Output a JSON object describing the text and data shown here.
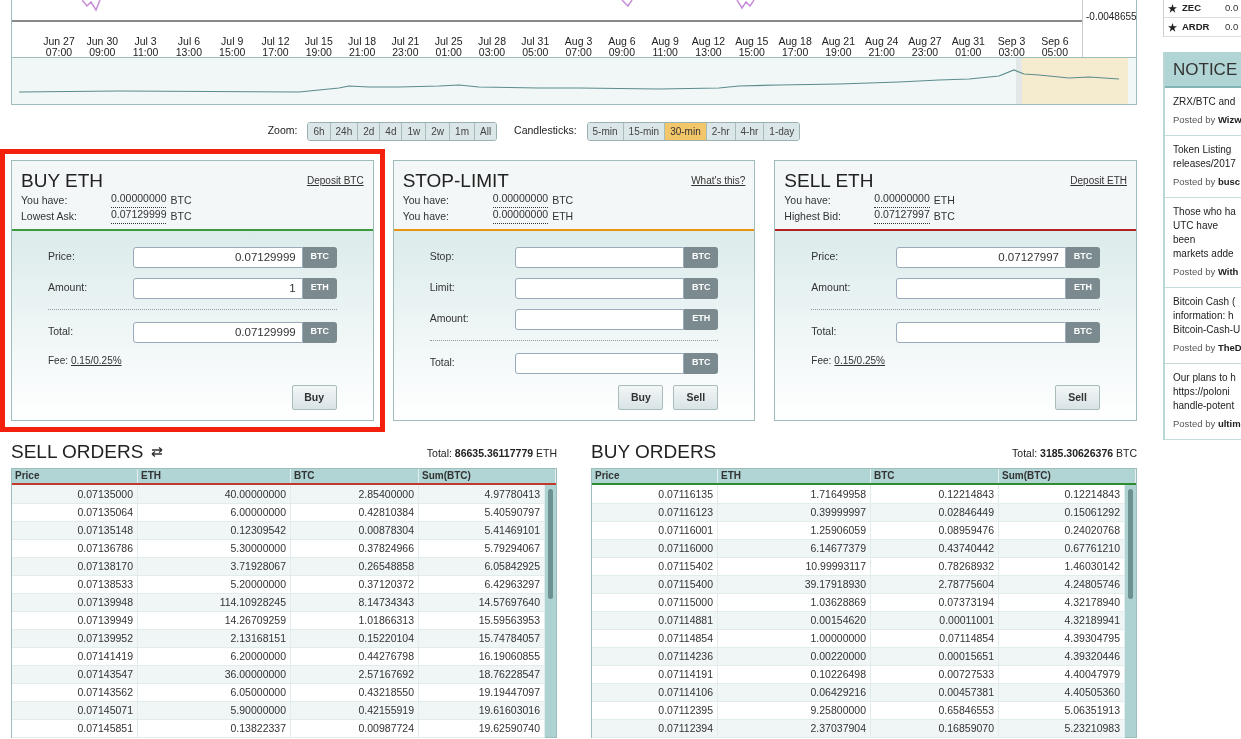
{
  "chart": {
    "y_labels": [
      "-0.0048655"
    ],
    "x_labels": [
      {
        "date": "Jun 27",
        "time": "07:00"
      },
      {
        "date": "Jun 30",
        "time": "09:00"
      },
      {
        "date": "Jul 3",
        "time": "11:00"
      },
      {
        "date": "Jul 6",
        "time": "13:00"
      },
      {
        "date": "Jul 9",
        "time": "15:00"
      },
      {
        "date": "Jul 12",
        "time": "17:00"
      },
      {
        "date": "Jul 15",
        "time": "19:00"
      },
      {
        "date": "Jul 18",
        "time": "21:00"
      },
      {
        "date": "Jul 21",
        "time": "23:00"
      },
      {
        "date": "Jul 25",
        "time": "01:00"
      },
      {
        "date": "Jul 28",
        "time": "03:00"
      },
      {
        "date": "Jul 31",
        "time": "05:00"
      },
      {
        "date": "Aug 3",
        "time": "07:00"
      },
      {
        "date": "Aug 6",
        "time": "09:00"
      },
      {
        "date": "Aug 9",
        "time": "11:00"
      },
      {
        "date": "Aug 12",
        "time": "13:00"
      },
      {
        "date": "Aug 15",
        "time": "15:00"
      },
      {
        "date": "Aug 18",
        "time": "17:00"
      },
      {
        "date": "Aug 21",
        "time": "19:00"
      },
      {
        "date": "Aug 24",
        "time": "21:00"
      },
      {
        "date": "Aug 27",
        "time": "23:00"
      },
      {
        "date": "Aug 31",
        "time": "01:00"
      },
      {
        "date": "Sep 3",
        "time": "03:00"
      },
      {
        "date": "Sep 6",
        "time": "05:00"
      }
    ]
  },
  "zoom": {
    "label": "Zoom:",
    "options": [
      {
        "label": "6h",
        "selected": false
      },
      {
        "label": "24h",
        "selected": false
      },
      {
        "label": "2d",
        "selected": false
      },
      {
        "label": "4d",
        "selected": false
      },
      {
        "label": "1w",
        "selected": false
      },
      {
        "label": "2w",
        "selected": false
      },
      {
        "label": "1m",
        "selected": false
      },
      {
        "label": "All",
        "selected": false
      }
    ]
  },
  "candlesticks": {
    "label": "Candlesticks:",
    "options": [
      {
        "label": "5-min",
        "selected": false
      },
      {
        "label": "15-min",
        "selected": false
      },
      {
        "label": "30-min",
        "selected": true
      },
      {
        "label": "2-hr",
        "selected": false
      },
      {
        "label": "4-hr",
        "selected": false
      },
      {
        "label": "1-day",
        "selected": false
      }
    ]
  },
  "forms": [
    {
      "kind": "buy",
      "title": "BUY ETH",
      "link": "Deposit BTC",
      "highlighted": true,
      "info": [
        {
          "label": "You have:",
          "value": "0.00000000",
          "unit": "BTC"
        },
        {
          "label": "Lowest Ask:",
          "value": "0.07129999",
          "unit": "BTC"
        }
      ],
      "fields": [
        {
          "label": "Price:",
          "value": "0.07129999",
          "unit": "BTC",
          "divider_above": false
        },
        {
          "label": "Amount:",
          "value": "1",
          "unit": "ETH",
          "divider_above": false
        },
        {
          "label": "Total:",
          "value": "0.07129999",
          "unit": "BTC",
          "divider_above": true
        }
      ],
      "fee": {
        "label": "Fee:",
        "value": "0.15/0.25%"
      },
      "buttons": [
        "Buy"
      ]
    },
    {
      "kind": "stop",
      "title": "STOP-LIMIT",
      "link": "What's this?",
      "highlighted": false,
      "info": [
        {
          "label": "You have:",
          "value": "0.00000000",
          "unit": "BTC"
        },
        {
          "label": "You have:",
          "value": "0.00000000",
          "unit": "ETH"
        }
      ],
      "fields": [
        {
          "label": "Stop:",
          "unit": "BTC",
          "divider_above": false
        },
        {
          "label": "Limit:",
          "unit": "BTC",
          "divider_above": false
        },
        {
          "label": "Amount:",
          "unit": "ETH",
          "divider_above": false
        },
        {
          "label": "Total:",
          "unit": "BTC",
          "divider_above": true
        }
      ],
      "buttons": [
        "Buy",
        "Sell"
      ]
    },
    {
      "kind": "sell",
      "title": "SELL ETH",
      "link": "Deposit ETH",
      "highlighted": false,
      "info": [
        {
          "label": "You have:",
          "value": "0.00000000",
          "unit": "ETH"
        },
        {
          "label": "Highest Bid:",
          "value": "0.07127997",
          "unit": "BTC"
        }
      ],
      "fields": [
        {
          "label": "Price:",
          "value": "0.07127997",
          "unit": "BTC",
          "divider_above": false
        },
        {
          "label": "Amount:",
          "unit": "ETH",
          "divider_above": false
        },
        {
          "label": "Total:",
          "unit": "BTC",
          "divider_above": true
        }
      ],
      "fee": {
        "label": "Fee:",
        "value": "0.15/0.25%"
      },
      "buttons": [
        "Sell"
      ]
    }
  ],
  "order_books": [
    {
      "kind": "sell",
      "title": "SELL ORDERS",
      "swap_icon": true,
      "total_label": "Total:",
      "total": "86635.36117779",
      "total_unit": "ETH",
      "columns": [
        "Price",
        "ETH",
        "BTC",
        "Sum(BTC)"
      ],
      "rows": [
        [
          "0.07135000",
          "40.00000000",
          "2.85400000",
          "4.97780413"
        ],
        [
          "0.07135064",
          "6.00000000",
          "0.42810384",
          "5.40590797"
        ],
        [
          "0.07135148",
          "0.12309542",
          "0.00878304",
          "5.41469101"
        ],
        [
          "0.07136786",
          "5.30000000",
          "0.37824966",
          "5.79294067"
        ],
        [
          "0.07138170",
          "3.71928067",
          "0.26548858",
          "6.05842925"
        ],
        [
          "0.07138533",
          "5.20000000",
          "0.37120372",
          "6.42963297"
        ],
        [
          "0.07139948",
          "114.10928245",
          "8.14734343",
          "14.57697640"
        ],
        [
          "0.07139949",
          "14.26709259",
          "1.01866313",
          "15.59563953"
        ],
        [
          "0.07139952",
          "2.13168151",
          "0.15220104",
          "15.74784057"
        ],
        [
          "0.07141419",
          "6.20000000",
          "0.44276798",
          "16.19060855"
        ],
        [
          "0.07143547",
          "36.00000000",
          "2.57167692",
          "18.76228547"
        ],
        [
          "0.07143562",
          "6.05000000",
          "0.43218550",
          "19.19447097"
        ],
        [
          "0.07145071",
          "5.90000000",
          "0.42155919",
          "19.61603016"
        ],
        [
          "0.07145851",
          "0.13822337",
          "0.00987724",
          "19.62590740"
        ]
      ]
    },
    {
      "kind": "buy",
      "title": "BUY ORDERS",
      "swap_icon": false,
      "total_label": "Total:",
      "total": "3185.30626376",
      "total_unit": "BTC",
      "columns": [
        "Price",
        "ETH",
        "BTC",
        "Sum(BTC)"
      ],
      "rows": [
        [
          "0.07116135",
          "1.71649958",
          "0.12214843",
          "0.12214843"
        ],
        [
          "0.07116123",
          "0.39999997",
          "0.02846449",
          "0.15061292"
        ],
        [
          "0.07116001",
          "1.25906059",
          "0.08959476",
          "0.24020768"
        ],
        [
          "0.07116000",
          "6.14677379",
          "0.43740442",
          "0.67761210"
        ],
        [
          "0.07115402",
          "10.99993117",
          "0.78268932",
          "1.46030142"
        ],
        [
          "0.07115400",
          "39.17918930",
          "2.78775604",
          "4.24805746"
        ],
        [
          "0.07115000",
          "1.03628869",
          "0.07373194",
          "4.32178940"
        ],
        [
          "0.07114881",
          "0.00154620",
          "0.00011001",
          "4.32189941"
        ],
        [
          "0.07114854",
          "1.00000000",
          "0.07114854",
          "4.39304795"
        ],
        [
          "0.07114236",
          "0.00220000",
          "0.00015651",
          "4.39320446"
        ],
        [
          "0.07114191",
          "0.10226498",
          "0.00727533",
          "4.40047979"
        ],
        [
          "0.07114106",
          "0.06429216",
          "0.00457381",
          "4.40505360"
        ],
        [
          "0.07112395",
          "9.25800000",
          "0.65846553",
          "5.06351913"
        ],
        [
          "0.07112394",
          "2.37037904",
          "0.16859070",
          "5.23210983"
        ]
      ]
    }
  ],
  "sidebar": {
    "markets": [
      {
        "coin": "ZEC",
        "price": "0.0",
        "starred": true
      },
      {
        "coin": "ARDR",
        "price": "0.0",
        "starred": true
      }
    ],
    "notices": {
      "title": "NOTICE",
      "items": [
        {
          "lines": [
            "ZRX/BTC and"
          ],
          "posted_by": "Posted by",
          "author": "Wizw"
        },
        {
          "lines": [
            "Token Listing",
            "releases/2017"
          ],
          "posted_by": "Posted by",
          "author": "busc"
        },
        {
          "lines": [
            "Those who ha",
            "UTC have been",
            "markets adde"
          ],
          "posted_by": "Posted by",
          "author": "With"
        },
        {
          "lines": [
            "Bitcoin Cash (",
            "information: h",
            "Bitcoin-Cash-U"
          ],
          "posted_by": "Posted by",
          "author": "TheD"
        },
        {
          "lines": [
            "Our plans to h",
            "https://poloni",
            "handle-potent"
          ],
          "posted_by": "Posted by",
          "author": "ultim"
        }
      ]
    }
  }
}
